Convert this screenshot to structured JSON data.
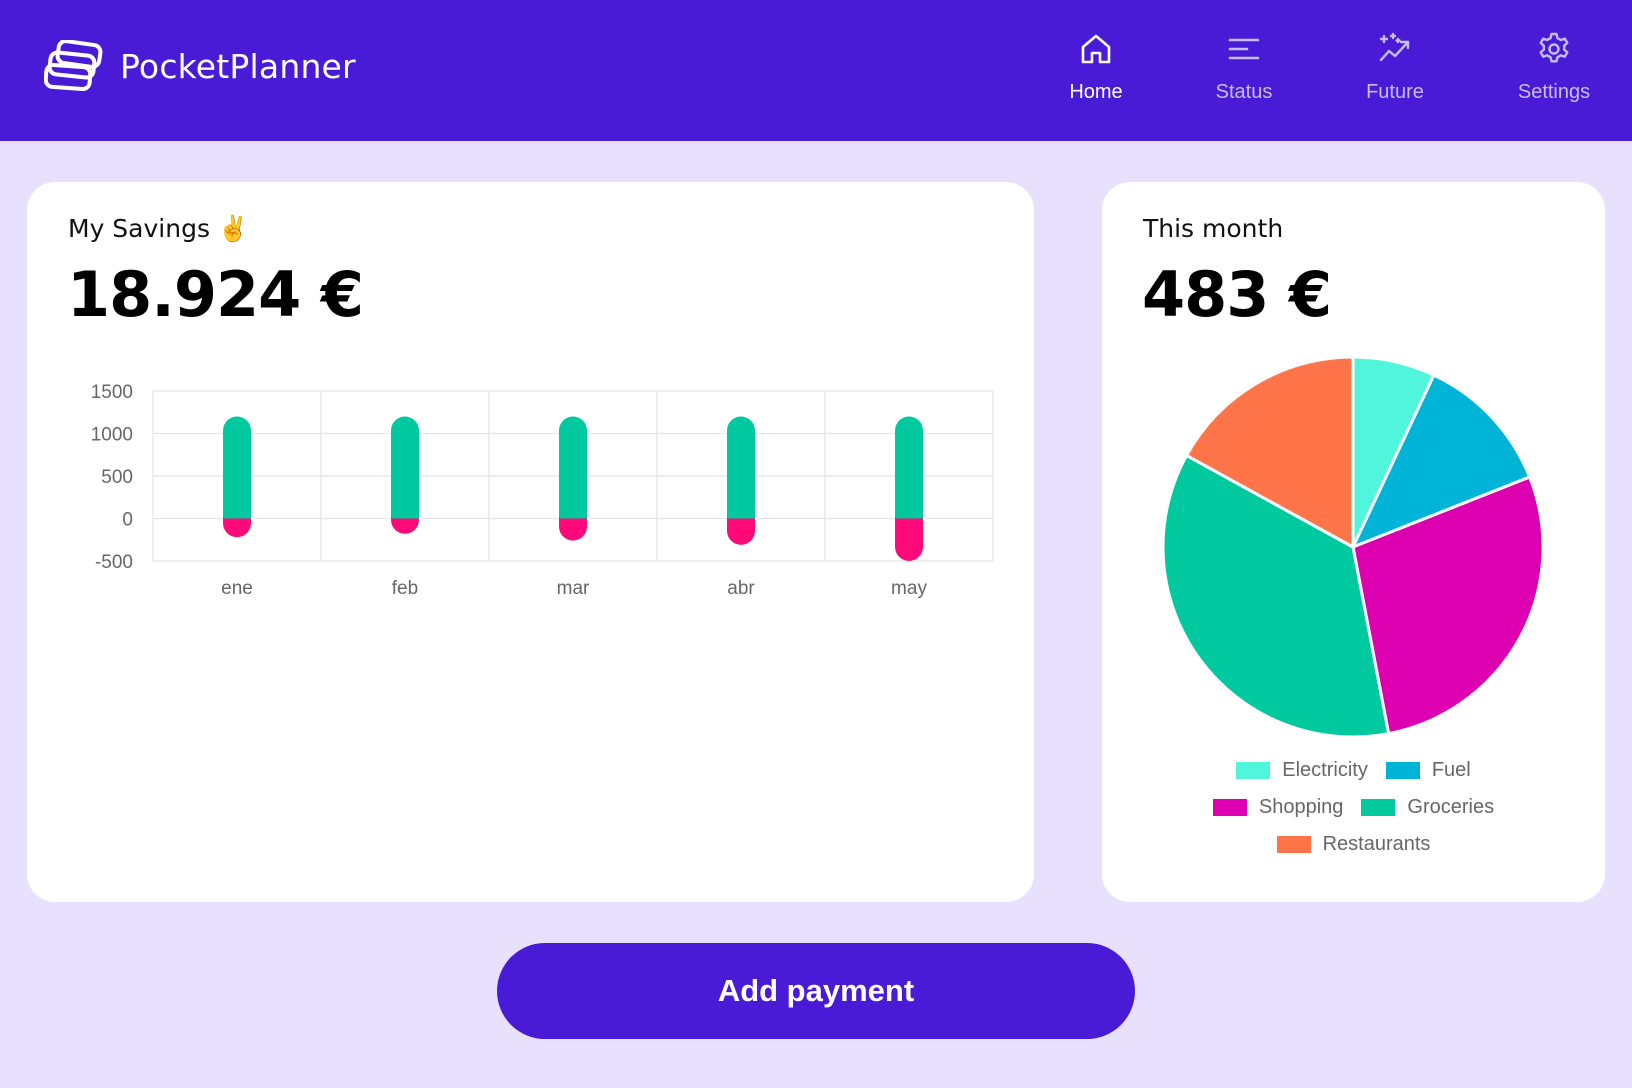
{
  "app": {
    "name": "PocketPlanner",
    "brand_color": "#4a1bd6",
    "background_color": "#e8e1fd"
  },
  "nav": {
    "items": [
      {
        "label": "Home",
        "icon": "home-icon",
        "active": true
      },
      {
        "label": "Status",
        "icon": "status-icon",
        "active": false
      },
      {
        "label": "Future",
        "icon": "future-icon",
        "active": false
      },
      {
        "label": "Settings",
        "icon": "gear-icon",
        "active": false
      }
    ]
  },
  "savings": {
    "title": "My Savings ✌️",
    "amount": "18.924 €"
  },
  "month": {
    "title": "This month",
    "amount": "483 €"
  },
  "actions": {
    "add_payment_label": "Add payment"
  },
  "chart_data": [
    {
      "type": "bar",
      "categories": [
        "ene",
        "feb",
        "mar",
        "abr",
        "may"
      ],
      "series": [
        {
          "values": [
            1200,
            1200,
            1200,
            1200,
            1200
          ],
          "color": "#00c9a0"
        },
        {
          "values": [
            -220,
            -180,
            -260,
            -310,
            -500
          ],
          "color": "#ff0a78"
        }
      ],
      "ylim": [
        -500,
        1500
      ],
      "yticks": [
        "1500",
        "1000",
        "500",
        "0",
        "-500"
      ],
      "grid": true,
      "stacked": true
    },
    {
      "type": "pie",
      "categories": [
        "Electricity",
        "Fuel",
        "Shopping",
        "Groceries",
        "Restaurants"
      ],
      "values": [
        7,
        12,
        28,
        36,
        17
      ],
      "colors": [
        "#50f5dc",
        "#00b4d8",
        "#dc00b0",
        "#00c9a0",
        "#ff7448"
      ],
      "legend": "bottom"
    }
  ]
}
